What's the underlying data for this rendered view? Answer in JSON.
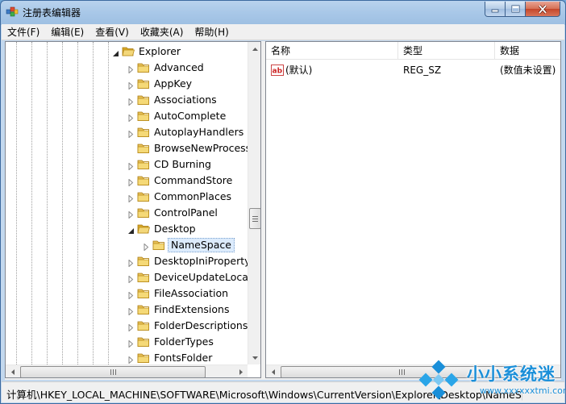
{
  "window": {
    "title": "注册表编辑器"
  },
  "menu": [
    {
      "label": "文件(F)"
    },
    {
      "label": "编辑(E)"
    },
    {
      "label": "查看(V)"
    },
    {
      "label": "收藏夹(A)"
    },
    {
      "label": "帮助(H)"
    }
  ],
  "tree": {
    "items": [
      {
        "label": "Explorer",
        "expander": "expanded"
      },
      {
        "label": "Advanced",
        "expander": "collapsed"
      },
      {
        "label": "AppKey",
        "expander": "collapsed"
      },
      {
        "label": "Associations",
        "expander": "collapsed"
      },
      {
        "label": "AutoComplete",
        "expander": "collapsed"
      },
      {
        "label": "AutoplayHandlers",
        "expander": "collapsed"
      },
      {
        "label": "BrowseNewProcess",
        "expander": "none"
      },
      {
        "label": "CD Burning",
        "expander": "collapsed"
      },
      {
        "label": "CommandStore",
        "expander": "collapsed"
      },
      {
        "label": "CommonPlaces",
        "expander": "collapsed"
      },
      {
        "label": "ControlPanel",
        "expander": "collapsed"
      },
      {
        "label": "Desktop",
        "expander": "expanded"
      },
      {
        "label": "NameSpace",
        "expander": "collapsed",
        "selected": true
      },
      {
        "label": "DesktopIniPropertyM",
        "expander": "collapsed"
      },
      {
        "label": "DeviceUpdateLocatic",
        "expander": "collapsed"
      },
      {
        "label": "FileAssociation",
        "expander": "collapsed"
      },
      {
        "label": "FindExtensions",
        "expander": "collapsed"
      },
      {
        "label": "FolderDescriptions",
        "expander": "collapsed"
      },
      {
        "label": "FolderTypes",
        "expander": "collapsed"
      },
      {
        "label": "FontsFolder",
        "expander": "collapsed"
      }
    ]
  },
  "list": {
    "columns": [
      "名称",
      "类型",
      "数据"
    ],
    "rows": [
      {
        "name": "(默认)",
        "type": "REG_SZ",
        "data": "(数值未设置)",
        "icon": "string-value-icon"
      }
    ]
  },
  "status": {
    "path": "计算机\\HKEY_LOCAL_MACHINE\\SOFTWARE\\Microsoft\\Windows\\CurrentVersion\\Explorer\\Desktop\\NameSpace"
  },
  "watermark": {
    "name": "小小系统迷",
    "url": "www.xxxxxxtmi.com"
  },
  "colors": {
    "accent": "#1a8fd9",
    "selection": "#dcebfc",
    "folder": "#e8c25a"
  }
}
